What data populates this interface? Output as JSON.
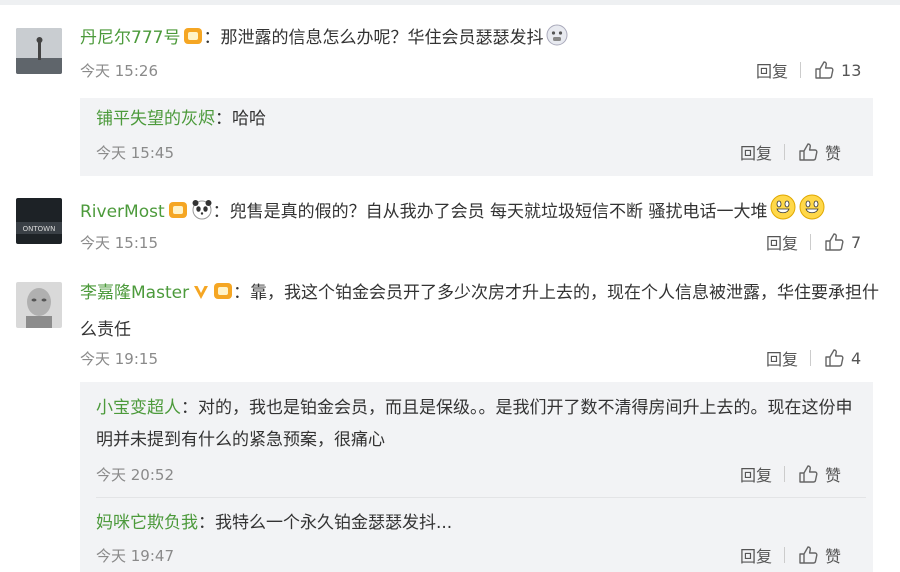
{
  "comments": [
    {
      "author": "丹尼尔777号",
      "text": "：那泄露的信息怎么办呢？华住会员瑟瑟发抖",
      "time": "今天 15:26",
      "reply_label": "回复",
      "likes": "13",
      "replies": [
        {
          "author": "铺平失望的灰烬",
          "text": "：哈哈",
          "time": "今天 15:45",
          "reply_label": "回复",
          "like_label": "赞"
        }
      ]
    },
    {
      "author": "RiverMost",
      "text": "：兜售是真的假的？自从我办了会员 每天就垃圾短信不断 骚扰电话一大堆",
      "time": "今天 15:15",
      "reply_label": "回复",
      "likes": "7",
      "avatar_text": "ONTOWN"
    },
    {
      "author": "李嘉隆Master",
      "text": "：靠，我这个铂金会员开了多少次房才升上去的，现在个人信息被泄露，华住要承担什么责任",
      "time": "今天 19:15",
      "reply_label": "回复",
      "likes": "4",
      "replies": [
        {
          "author": "小宝变超人",
          "text": "：对的，我也是铂金会员，而且是保级。。是我们开了数不清得房间升上去的。现在这份申明并未提到有什么的紧急预案，很痛心",
          "time": "今天 20:52",
          "reply_label": "回复",
          "like_label": "赞"
        },
        {
          "author": "妈咪它欺负我",
          "text": "：我特么一个永久铂金瑟瑟发抖...",
          "time": "今天 19:47",
          "reply_label": "回复",
          "like_label": "赞"
        }
      ]
    }
  ],
  "colors": {
    "name": "#4c9a3b",
    "text": "#333333",
    "time": "#8a8a8a",
    "reply_bg": "#f2f3f5",
    "badge": "#f5a623"
  },
  "icons": [
    "like-icon",
    "v-badge-icon",
    "member-badge-icon",
    "panda-emoji-icon",
    "scared-emoji-icon",
    "grin-emoji-icon"
  ]
}
